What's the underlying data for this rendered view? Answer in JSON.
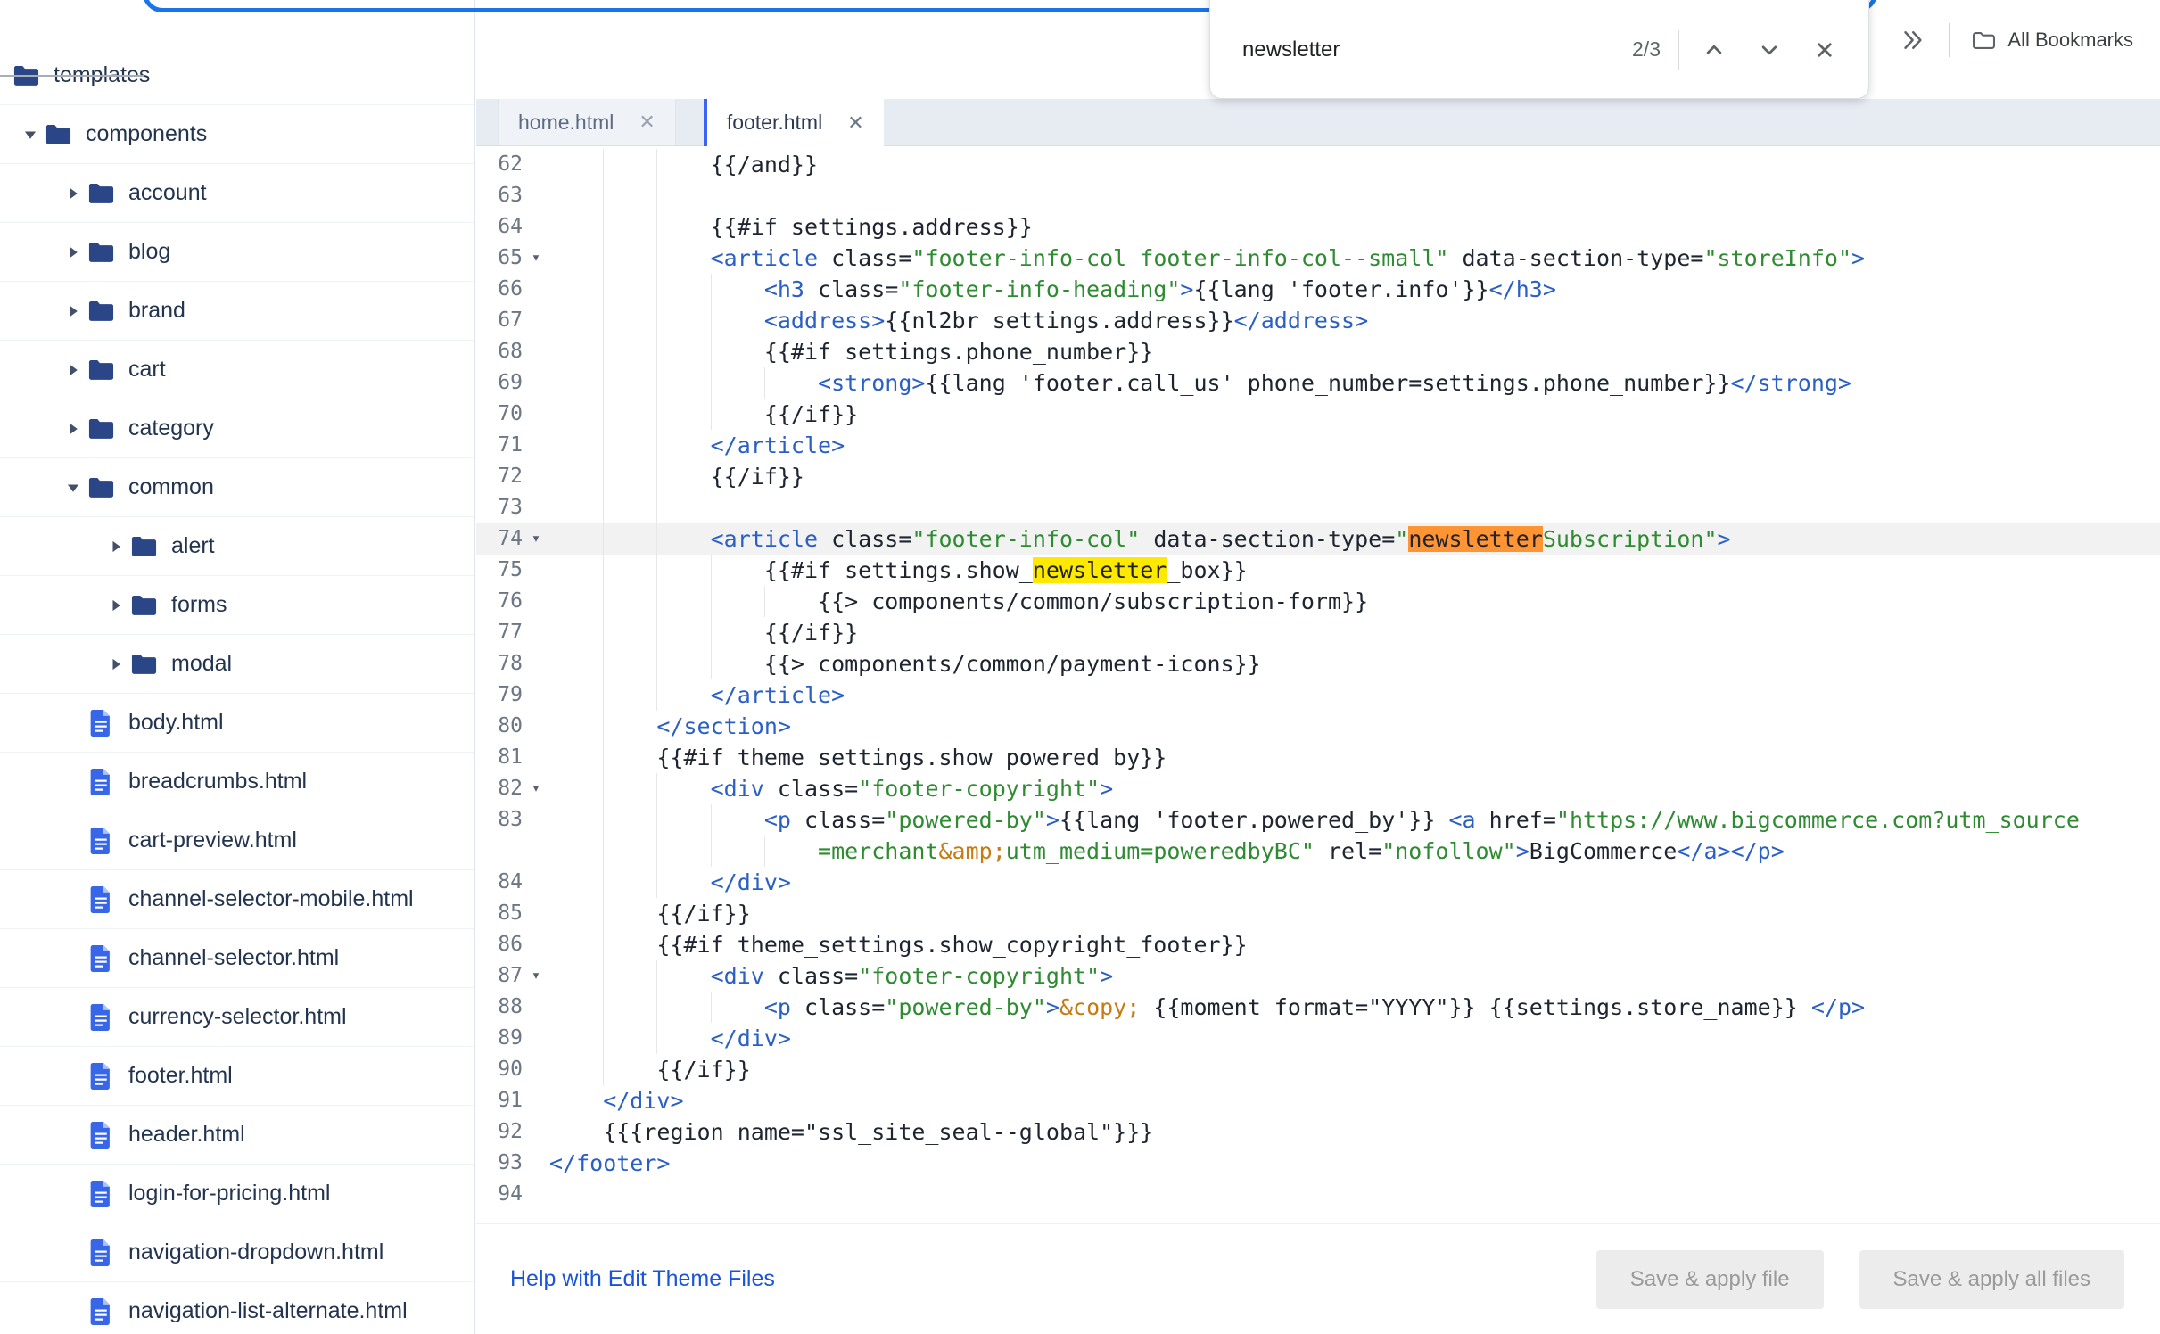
{
  "browser": {
    "find": {
      "query": "newsletter",
      "count": "2/3"
    },
    "all_bookmarks_label": "All Bookmarks",
    "icons": {
      "overflow": "double-chevron-right",
      "all_bookmarks": "folder-outline",
      "find_previous": "chevron-up",
      "find_next": "chevron-down",
      "find_close": "close-x"
    }
  },
  "sidebar": {
    "items": [
      {
        "label": "templates",
        "type": "folder",
        "level": 0,
        "expanded": true,
        "root": true
      },
      {
        "label": "components",
        "type": "folder",
        "level": 0,
        "expanded": true
      },
      {
        "label": "account",
        "type": "folder",
        "level": 1,
        "expanded": false
      },
      {
        "label": "blog",
        "type": "folder",
        "level": 1,
        "expanded": false
      },
      {
        "label": "brand",
        "type": "folder",
        "level": 1,
        "expanded": false
      },
      {
        "label": "cart",
        "type": "folder",
        "level": 1,
        "expanded": false
      },
      {
        "label": "category",
        "type": "folder",
        "level": 1,
        "expanded": false
      },
      {
        "label": "common",
        "type": "folder",
        "level": 1,
        "expanded": true
      },
      {
        "label": "alert",
        "type": "folder",
        "level": 2,
        "expanded": false
      },
      {
        "label": "forms",
        "type": "folder",
        "level": 2,
        "expanded": false
      },
      {
        "label": "modal",
        "type": "folder",
        "level": 2,
        "expanded": false
      },
      {
        "label": "body.html",
        "type": "file",
        "level": 1
      },
      {
        "label": "breadcrumbs.html",
        "type": "file",
        "level": 1
      },
      {
        "label": "cart-preview.html",
        "type": "file",
        "level": 1
      },
      {
        "label": "channel-selector-mobile.html",
        "type": "file",
        "level": 1
      },
      {
        "label": "channel-selector.html",
        "type": "file",
        "level": 1
      },
      {
        "label": "currency-selector.html",
        "type": "file",
        "level": 1
      },
      {
        "label": "footer.html",
        "type": "file",
        "level": 1
      },
      {
        "label": "header.html",
        "type": "file",
        "level": 1
      },
      {
        "label": "login-for-pricing.html",
        "type": "file",
        "level": 1
      },
      {
        "label": "navigation-dropdown.html",
        "type": "file",
        "level": 1
      },
      {
        "label": "navigation-list-alternate.html",
        "type": "file",
        "level": 1
      }
    ]
  },
  "tabs": [
    {
      "label": "home.html",
      "close": "✕",
      "active": false
    },
    {
      "label": "footer.html",
      "close": "✕",
      "active": true
    }
  ],
  "editor": {
    "rows": [
      {
        "n": "62",
        "i": 12,
        "s": [
          [
            "d",
            "{{/and}}"
          ]
        ]
      },
      {
        "n": "63",
        "i": 12,
        "s": []
      },
      {
        "n": "64",
        "i": 12,
        "s": [
          [
            "d",
            "{{#if settings.address}}"
          ]
        ]
      },
      {
        "n": "65",
        "i": 12,
        "fold": true,
        "s": [
          [
            "t",
            "<article"
          ],
          [
            "d",
            " class="
          ],
          [
            "s",
            "\"footer-info-col footer-info-col--small\""
          ],
          [
            "d",
            " data-section-type="
          ],
          [
            "s",
            "\"storeInfo\""
          ],
          [
            "t",
            ">"
          ]
        ]
      },
      {
        "n": "66",
        "i": 16,
        "s": [
          [
            "t",
            "<h3"
          ],
          [
            "d",
            " class="
          ],
          [
            "s",
            "\"footer-info-heading\""
          ],
          [
            "t",
            ">"
          ],
          [
            "d",
            "{{lang 'footer.info'}}"
          ],
          [
            "t",
            "</h3>"
          ]
        ]
      },
      {
        "n": "67",
        "i": 16,
        "s": [
          [
            "t",
            "<address>"
          ],
          [
            "d",
            "{{nl2br settings.address}}"
          ],
          [
            "t",
            "</address>"
          ]
        ]
      },
      {
        "n": "68",
        "i": 16,
        "s": [
          [
            "d",
            "{{#if settings.phone_number}}"
          ]
        ]
      },
      {
        "n": "69",
        "i": 20,
        "s": [
          [
            "t",
            "<strong>"
          ],
          [
            "d",
            "{{lang 'footer.call_us' phone_number=settings.phone_number}}"
          ],
          [
            "t",
            "</strong>"
          ]
        ]
      },
      {
        "n": "70",
        "i": 16,
        "s": [
          [
            "d",
            "{{/if}}"
          ]
        ]
      },
      {
        "n": "71",
        "i": 12,
        "s": [
          [
            "t",
            "</article>"
          ]
        ]
      },
      {
        "n": "72",
        "i": 12,
        "s": [
          [
            "d",
            "{{/if}}"
          ]
        ]
      },
      {
        "n": "73",
        "i": 12,
        "s": []
      },
      {
        "n": "74",
        "i": 12,
        "fold": true,
        "active": true,
        "s": [
          [
            "t",
            "<article"
          ],
          [
            "d",
            " class="
          ],
          [
            "s",
            "\"footer-info-col\""
          ],
          [
            "d",
            " data-section-type="
          ],
          [
            "s",
            "\""
          ],
          [
            "ho",
            "newsletter"
          ],
          [
            "s",
            "Subscription\""
          ],
          [
            "t",
            ">"
          ]
        ]
      },
      {
        "n": "75",
        "i": 16,
        "s": [
          [
            "d",
            "{{#if settings.show_"
          ],
          [
            "hy",
            "newsletter"
          ],
          [
            "d",
            "_box}}"
          ]
        ]
      },
      {
        "n": "76",
        "i": 20,
        "s": [
          [
            "d",
            "{{> components/common/subscription-form}}"
          ]
        ]
      },
      {
        "n": "77",
        "i": 16,
        "s": [
          [
            "d",
            "{{/if}}"
          ]
        ]
      },
      {
        "n": "78",
        "i": 16,
        "s": [
          [
            "d",
            "{{> components/common/payment-icons}}"
          ]
        ]
      },
      {
        "n": "79",
        "i": 12,
        "s": [
          [
            "t",
            "</article>"
          ]
        ]
      },
      {
        "n": "80",
        "i": 8,
        "s": [
          [
            "t",
            "</section>"
          ]
        ]
      },
      {
        "n": "81",
        "i": 8,
        "s": [
          [
            "d",
            "{{#if theme_settings.show_powered_by}}"
          ]
        ]
      },
      {
        "n": "82",
        "i": 12,
        "fold": true,
        "s": [
          [
            "t",
            "<div"
          ],
          [
            "d",
            " class="
          ],
          [
            "s",
            "\"footer-copyright\""
          ],
          [
            "t",
            ">"
          ]
        ]
      },
      {
        "n": "83",
        "i": 16,
        "s": [
          [
            "t",
            "<p"
          ],
          [
            "d",
            " class="
          ],
          [
            "s",
            "\"powered-by\""
          ],
          [
            "t",
            ">"
          ],
          [
            "d",
            "{{lang 'footer.powered_by'}} "
          ],
          [
            "t",
            "<a"
          ],
          [
            "d",
            " href="
          ],
          [
            "s",
            "\"https://www.bigcommerce.com?utm_source"
          ]
        ]
      },
      {
        "n": "",
        "i": 20,
        "s": [
          [
            "s",
            "=merchant"
          ],
          [
            "e",
            "&amp;"
          ],
          [
            "s",
            "utm_medium=poweredbyBC\""
          ],
          [
            "d",
            " rel="
          ],
          [
            "s",
            "\"nofollow\""
          ],
          [
            "t",
            ">"
          ],
          [
            "d",
            "BigCommerce"
          ],
          [
            "t",
            "</a></p>"
          ]
        ]
      },
      {
        "n": "84",
        "i": 12,
        "s": [
          [
            "t",
            "</div>"
          ]
        ]
      },
      {
        "n": "85",
        "i": 8,
        "s": [
          [
            "d",
            "{{/if}}"
          ]
        ]
      },
      {
        "n": "86",
        "i": 8,
        "s": [
          [
            "d",
            "{{#if theme_settings.show_copyright_footer}}"
          ]
        ]
      },
      {
        "n": "87",
        "i": 12,
        "fold": true,
        "s": [
          [
            "t",
            "<div"
          ],
          [
            "d",
            " class="
          ],
          [
            "s",
            "\"footer-copyright\""
          ],
          [
            "t",
            ">"
          ]
        ]
      },
      {
        "n": "88",
        "i": 16,
        "s": [
          [
            "t",
            "<p"
          ],
          [
            "d",
            " class="
          ],
          [
            "s",
            "\"powered-by\""
          ],
          [
            "t",
            ">"
          ],
          [
            "e",
            "&copy;"
          ],
          [
            "d",
            " {{moment format=\"YYYY\"}} {{settings.store_name}} "
          ],
          [
            "t",
            "</p>"
          ]
        ]
      },
      {
        "n": "89",
        "i": 12,
        "s": [
          [
            "t",
            "</div>"
          ]
        ]
      },
      {
        "n": "90",
        "i": 8,
        "s": [
          [
            "d",
            "{{/if}}"
          ]
        ]
      },
      {
        "n": "91",
        "i": 4,
        "s": [
          [
            "t",
            "</div>"
          ]
        ]
      },
      {
        "n": "92",
        "i": 4,
        "s": [
          [
            "d",
            "{{{region name=\"ssl_site_seal--global\"}}}"
          ]
        ]
      },
      {
        "n": "93",
        "i": 0,
        "s": [
          [
            "t",
            "</footer>"
          ]
        ]
      },
      {
        "n": "94",
        "i": 0,
        "s": []
      }
    ]
  },
  "bottom": {
    "help_link": "Help with Edit Theme Files",
    "save_file": "Save & apply file",
    "save_all": "Save & apply all files"
  },
  "colors": {
    "accent_blue": "#3c64f4",
    "focus_ring": "#1a73e8",
    "find_active_highlight": "#ff9435",
    "find_match_highlight": "#ffe900",
    "tag_blue": "#2a5fc4",
    "string_green": "#2f8b31",
    "entity_orange": "#c67b14"
  }
}
